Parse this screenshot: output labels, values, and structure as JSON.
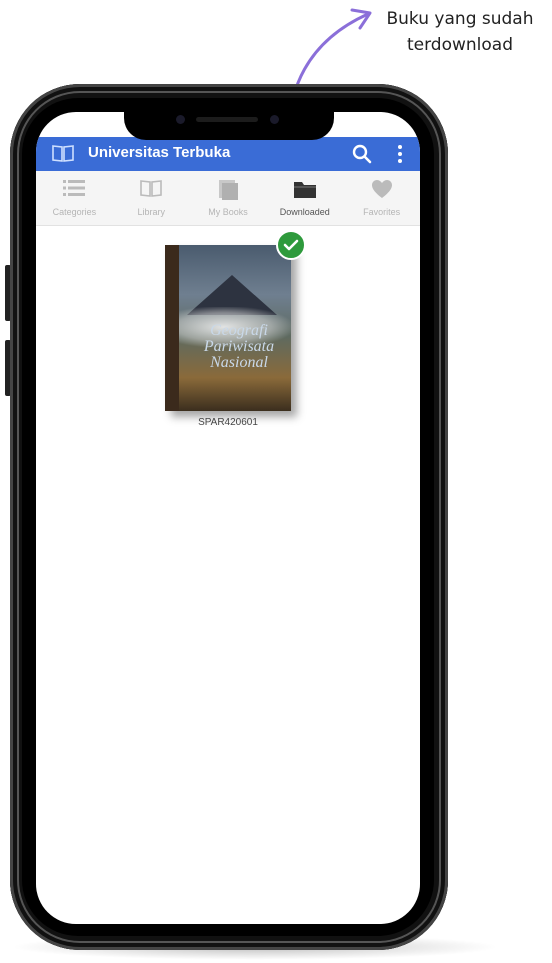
{
  "annotation": {
    "line1": "Buku yang sudah",
    "line2": "terdownload"
  },
  "app": {
    "title": "Universitas Terbuka",
    "header_color": "#3a6cd6"
  },
  "tabs": [
    {
      "label": "Categories",
      "icon": "list-icon",
      "active": false
    },
    {
      "label": "Library",
      "icon": "book-open-icon",
      "active": false
    },
    {
      "label": "My Books",
      "icon": "books-icon",
      "active": false
    },
    {
      "label": "Downloaded",
      "icon": "folder-icon",
      "active": true
    },
    {
      "label": "Favorites",
      "icon": "heart-icon",
      "active": false
    }
  ],
  "books": [
    {
      "code": "SPAR420601",
      "cover_title": "Geografi Pariwisata Nasional",
      "downloaded": true,
      "badge_color": "#2e9a3c"
    }
  ]
}
